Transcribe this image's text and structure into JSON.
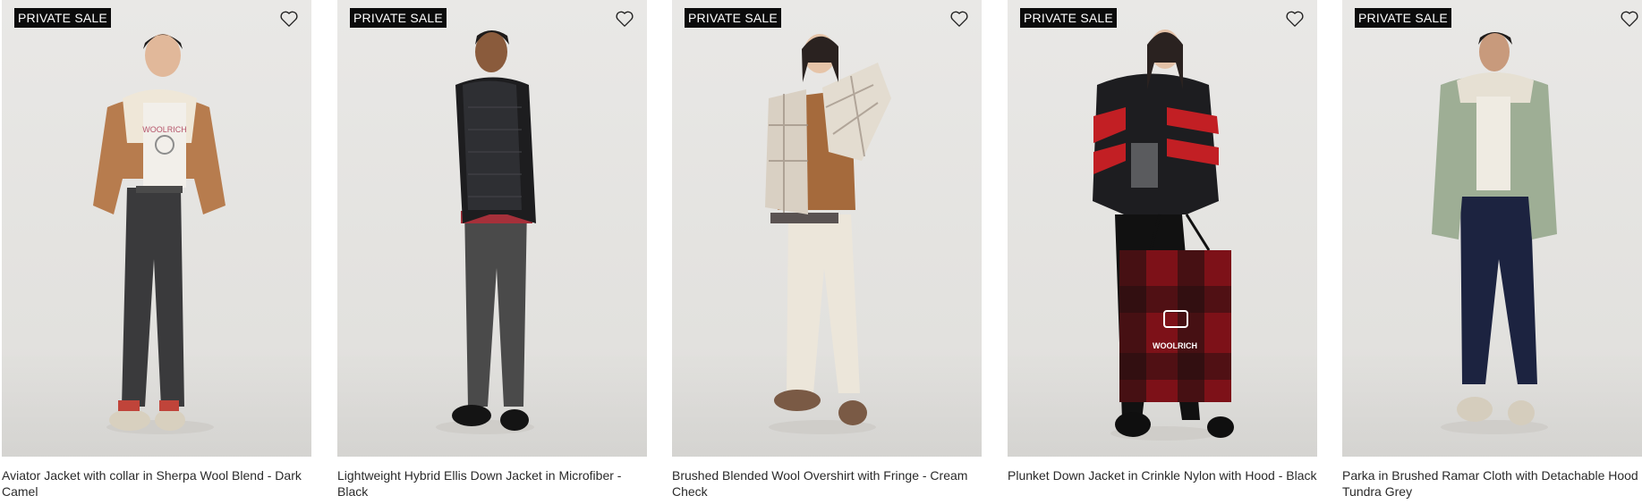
{
  "products": [
    {
      "badge": "PRIVATE SALE",
      "title": "Aviator Jacket with collar in Sherpa Wool Blend - Dark Camel"
    },
    {
      "badge": "PRIVATE SALE",
      "title": "Lightweight Hybrid Ellis Down Jacket in Microfiber - Black"
    },
    {
      "badge": "PRIVATE SALE",
      "title": "Brushed Blended Wool Overshirt with Fringe - Cream Check"
    },
    {
      "badge": "PRIVATE SALE",
      "title": "Plunket Down Jacket in Crinkle Nylon with Hood - Black"
    },
    {
      "badge": "PRIVATE SALE",
      "title": "Parka in Brushed Ramar Cloth with Detachable Hood - Tundra Grey"
    }
  ],
  "icons": {
    "favorite": "heart-outline-icon"
  },
  "bag_logo": "WOOLRICH",
  "colors": {
    "badge_bg": "#0b0b0b",
    "badge_text": "#ffffff",
    "photo_bg": "#e5e4e1",
    "title_text": "#2a2a2a"
  }
}
